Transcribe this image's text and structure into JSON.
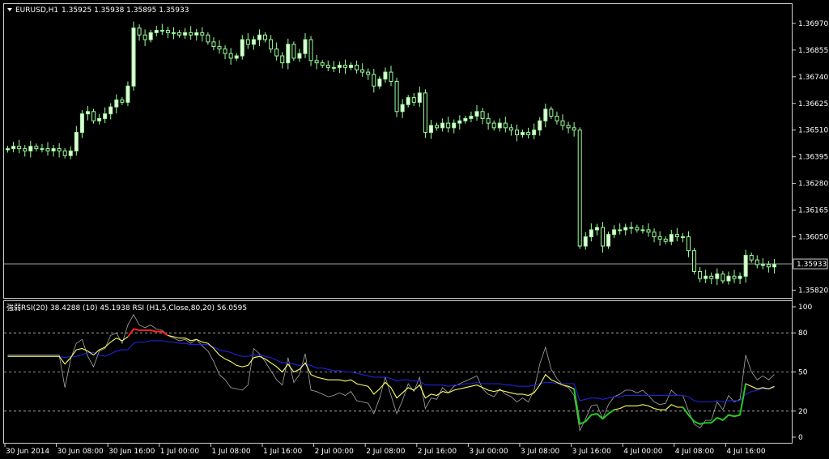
{
  "header": {
    "symbol": "EURUSD,H1",
    "ohlc": "1.35925 1.35938 1.35895 1.35933"
  },
  "rsi_header": "強弱RSI(20) 38.4288  (10) 45.1938  RSI (H1,5,Close,80,20) 56.0595",
  "colors": {
    "background": "#000000",
    "frame": "#cfcfcf",
    "bull_candle": "#e8ffe0",
    "bear_candle": "#000000",
    "candle_outline": "#9bff9b",
    "bid_line": "#9aa0a0",
    "rsi20": "#2222dd",
    "rsi10": "#ffff66",
    "rsi5": "#a8a8a8",
    "overbought": "#ff2020",
    "oversold": "#22cc22"
  },
  "chart_data": [
    {
      "type": "candlestick",
      "title": "EURUSD,H1",
      "y_ticks": [
        "1.36970",
        "1.36855",
        "1.36740",
        "1.36625",
        "1.36510",
        "1.36395",
        "1.36280",
        "1.36165",
        "1.36050",
        "1.35820"
      ],
      "ylim": [
        1.3579,
        1.3705
      ],
      "last_price": "1.35933",
      "x_ticks": [
        "30 Jun 2014",
        "30 Jun 08:00",
        "30 Jun 16:00",
        "1 Jul 00:00",
        "1 Jul 08:00",
        "1 Jul 16:00",
        "2 Jul 00:00",
        "2 Jul 08:00",
        "2 Jul 16:00",
        "3 Jul 00:00",
        "3 Jul 08:00",
        "3 Jul 16:00",
        "4 Jul 00:00",
        "4 Jul 08:00",
        "4 Jul 16:00"
      ],
      "close": [
        1.3643,
        1.3644,
        1.3643,
        1.3642,
        1.3644,
        1.3643,
        1.3643,
        1.3642,
        1.3643,
        1.3642,
        1.364,
        1.3642,
        1.365,
        1.3658,
        1.3659,
        1.3655,
        1.3656,
        1.3658,
        1.3661,
        1.3664,
        1.3663,
        1.367,
        1.3695,
        1.3692,
        1.369,
        1.3693,
        1.3694,
        1.3694,
        1.3693,
        1.3693,
        1.3692,
        1.3693,
        1.3692,
        1.3693,
        1.3692,
        1.3689,
        1.3687,
        1.3686,
        1.3684,
        1.3682,
        1.3683,
        1.369,
        1.3688,
        1.369,
        1.3692,
        1.369,
        1.3686,
        1.3683,
        1.368,
        1.3688,
        1.3682,
        1.3684,
        1.369,
        1.3681,
        1.368,
        1.3679,
        1.3678,
        1.3678,
        1.3679,
        1.3678,
        1.3679,
        1.3677,
        1.3676,
        1.3675,
        1.367,
        1.3673,
        1.3676,
        1.3672,
        1.3659,
        1.3662,
        1.3665,
        1.3663,
        1.3667,
        1.365,
        1.3653,
        1.3652,
        1.3654,
        1.3652,
        1.3654,
        1.3655,
        1.3656,
        1.3657,
        1.3659,
        1.3656,
        1.3654,
        1.3652,
        1.3654,
        1.3652,
        1.3651,
        1.3649,
        1.365,
        1.3649,
        1.3651,
        1.3655,
        1.366,
        1.3657,
        1.3655,
        1.3653,
        1.3652,
        1.3651,
        1.3601,
        1.3605,
        1.3608,
        1.3609,
        1.3601,
        1.3606,
        1.3608,
        1.3608,
        1.3609,
        1.3609,
        1.3608,
        1.3608,
        1.3607,
        1.3605,
        1.3604,
        1.3603,
        1.3606,
        1.3605,
        1.3605,
        1.3599,
        1.359,
        1.3587,
        1.3588,
        1.3587,
        1.3589,
        1.3586,
        1.3588,
        1.3587,
        1.3588,
        1.3597,
        1.3595,
        1.3593,
        1.3593,
        1.3592,
        1.3593
      ],
      "ma_note": ""
    },
    {
      "type": "line",
      "title": "RSI",
      "ylim": [
        0,
        100
      ],
      "y_ticks": [
        "100",
        "80",
        "50",
        "20",
        "0"
      ],
      "levels": [
        80,
        50,
        20
      ],
      "series": [
        {
          "name": "RSI(20)",
          "values": [
            62,
            62,
            62,
            62,
            62,
            62,
            62,
            62,
            62,
            62,
            61,
            62,
            62,
            63,
            65,
            65,
            63,
            62,
            64,
            66,
            67,
            67,
            72,
            73,
            73,
            74,
            74,
            74,
            73,
            73,
            72,
            72,
            71,
            71,
            71,
            71,
            69,
            67,
            66,
            65,
            63,
            62,
            62,
            63,
            63,
            62,
            61,
            59,
            57,
            57,
            56,
            55,
            56,
            55,
            53,
            53,
            52,
            51,
            51,
            50,
            50,
            49,
            48,
            47,
            46,
            46,
            46,
            45,
            43,
            44,
            44,
            43,
            43,
            40,
            40,
            40,
            40,
            39,
            40,
            40,
            41,
            41,
            42,
            41,
            41,
            41,
            41,
            40,
            40,
            39,
            39,
            39,
            40,
            41,
            42,
            42,
            41,
            41,
            41,
            41,
            28,
            29,
            30,
            30,
            29,
            30,
            31,
            31,
            32,
            32,
            32,
            32,
            32,
            32,
            32,
            32,
            32,
            32,
            32,
            31,
            28,
            27,
            27,
            27,
            28,
            27,
            28,
            28,
            28,
            33,
            35,
            36,
            37,
            37,
            38
          ]
        },
        {
          "name": "RSI(10)",
          "values": [
            62,
            62,
            62,
            62,
            62,
            62,
            62,
            62,
            62,
            62,
            56,
            61,
            67,
            68,
            66,
            63,
            67,
            69,
            73,
            76,
            74,
            77,
            83,
            82,
            82,
            82,
            81,
            81,
            78,
            77,
            76,
            76,
            74,
            75,
            73,
            72,
            68,
            63,
            60,
            58,
            55,
            54,
            55,
            61,
            62,
            60,
            57,
            54,
            50,
            56,
            50,
            52,
            57,
            48,
            46,
            45,
            44,
            44,
            44,
            43,
            44,
            41,
            40,
            39,
            33,
            37,
            42,
            38,
            30,
            34,
            38,
            36,
            40,
            30,
            33,
            32,
            35,
            34,
            36,
            37,
            38,
            39,
            40,
            38,
            36,
            35,
            36,
            35,
            34,
            33,
            33,
            32,
            34,
            40,
            48,
            44,
            42,
            40,
            39,
            37,
            10,
            12,
            17,
            18,
            14,
            18,
            21,
            22,
            24,
            24,
            24,
            25,
            24,
            22,
            21,
            21,
            25,
            23,
            23,
            17,
            12,
            10,
            11,
            11,
            15,
            13,
            17,
            16,
            17,
            41,
            39,
            37,
            38,
            37,
            39
          ]
        },
        {
          "name": "RSI(5)",
          "values": [
            63,
            63,
            63,
            63,
            63,
            63,
            63,
            63,
            63,
            63,
            38,
            60,
            72,
            75,
            62,
            54,
            66,
            68,
            78,
            80,
            72,
            86,
            94,
            86,
            84,
            86,
            83,
            82,
            78,
            76,
            74,
            75,
            72,
            75,
            70,
            66,
            58,
            48,
            44,
            38,
            37,
            36,
            40,
            68,
            64,
            58,
            51,
            44,
            40,
            61,
            42,
            48,
            64,
            36,
            35,
            33,
            31,
            32,
            34,
            32,
            35,
            28,
            27,
            26,
            18,
            30,
            46,
            32,
            18,
            28,
            41,
            35,
            46,
            22,
            30,
            29,
            38,
            34,
            39,
            41,
            43,
            45,
            47,
            37,
            33,
            31,
            37,
            33,
            31,
            27,
            30,
            27,
            36,
            56,
            69,
            52,
            45,
            40,
            38,
            32,
            5,
            14,
            24,
            25,
            14,
            25,
            31,
            33,
            36,
            36,
            34,
            36,
            32,
            27,
            25,
            26,
            36,
            32,
            32,
            20,
            10,
            7,
            13,
            13,
            27,
            21,
            32,
            27,
            29,
            63,
            50,
            44,
            47,
            44,
            48
          ]
        }
      ]
    }
  ]
}
